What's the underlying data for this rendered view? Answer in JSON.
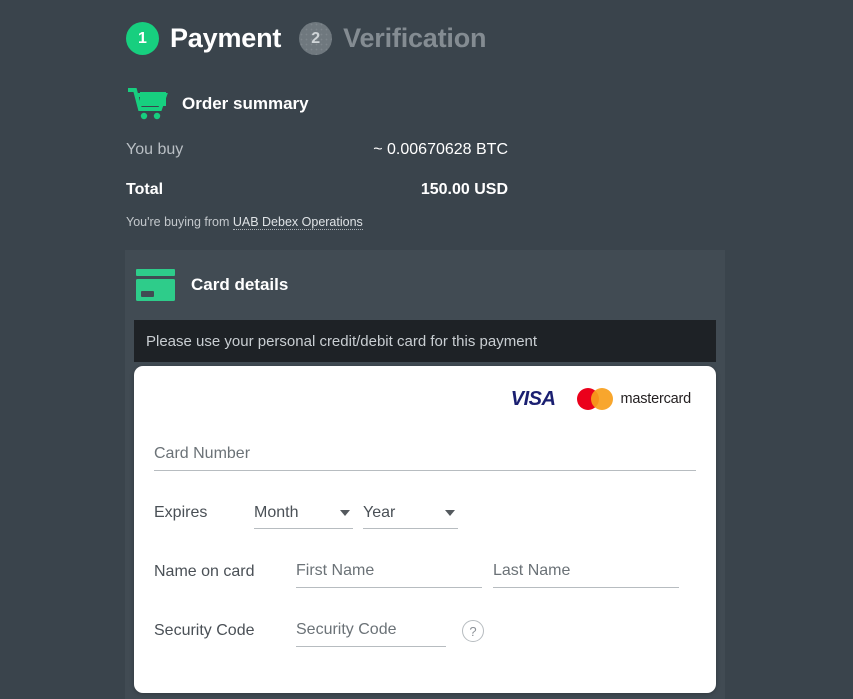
{
  "steps": [
    {
      "number": "1",
      "label": "Payment",
      "state": "active"
    },
    {
      "number": "2",
      "label": "Verification",
      "state": "inactive"
    }
  ],
  "order_summary": {
    "icon": "shopping-cart-icon",
    "title": "Order summary",
    "you_buy_label": "You buy",
    "you_buy_value": "~ 0.00670628 BTC",
    "total_label": "Total",
    "total_value": "150.00 USD",
    "seller_prefix": "You're buying from ",
    "seller_name": "UAB Debex Operations"
  },
  "card_details": {
    "icon": "credit-card-icon",
    "title": "Card details",
    "notice": "Please use your personal credit/debit card for this payment",
    "brands": {
      "visa": "VISA",
      "mastercard": "mastercard"
    },
    "fields": {
      "card_number_placeholder": "Card Number",
      "expires_label": "Expires",
      "month_selected": "Month",
      "year_selected": "Year",
      "name_label": "Name on card",
      "first_name_placeholder": "First Name",
      "last_name_placeholder": "Last Name",
      "security_label": "Security Code",
      "security_placeholder": "Security Code",
      "help_glyph": "?"
    }
  },
  "colors": {
    "page_background": "#3a444c",
    "panel_background": "#414b53",
    "accent_green": "#17cf7f",
    "notice_background": "#1e2226",
    "visa_blue": "#1a1f71",
    "mastercard_red": "#eb001b",
    "mastercard_orange": "#f79e1b"
  }
}
